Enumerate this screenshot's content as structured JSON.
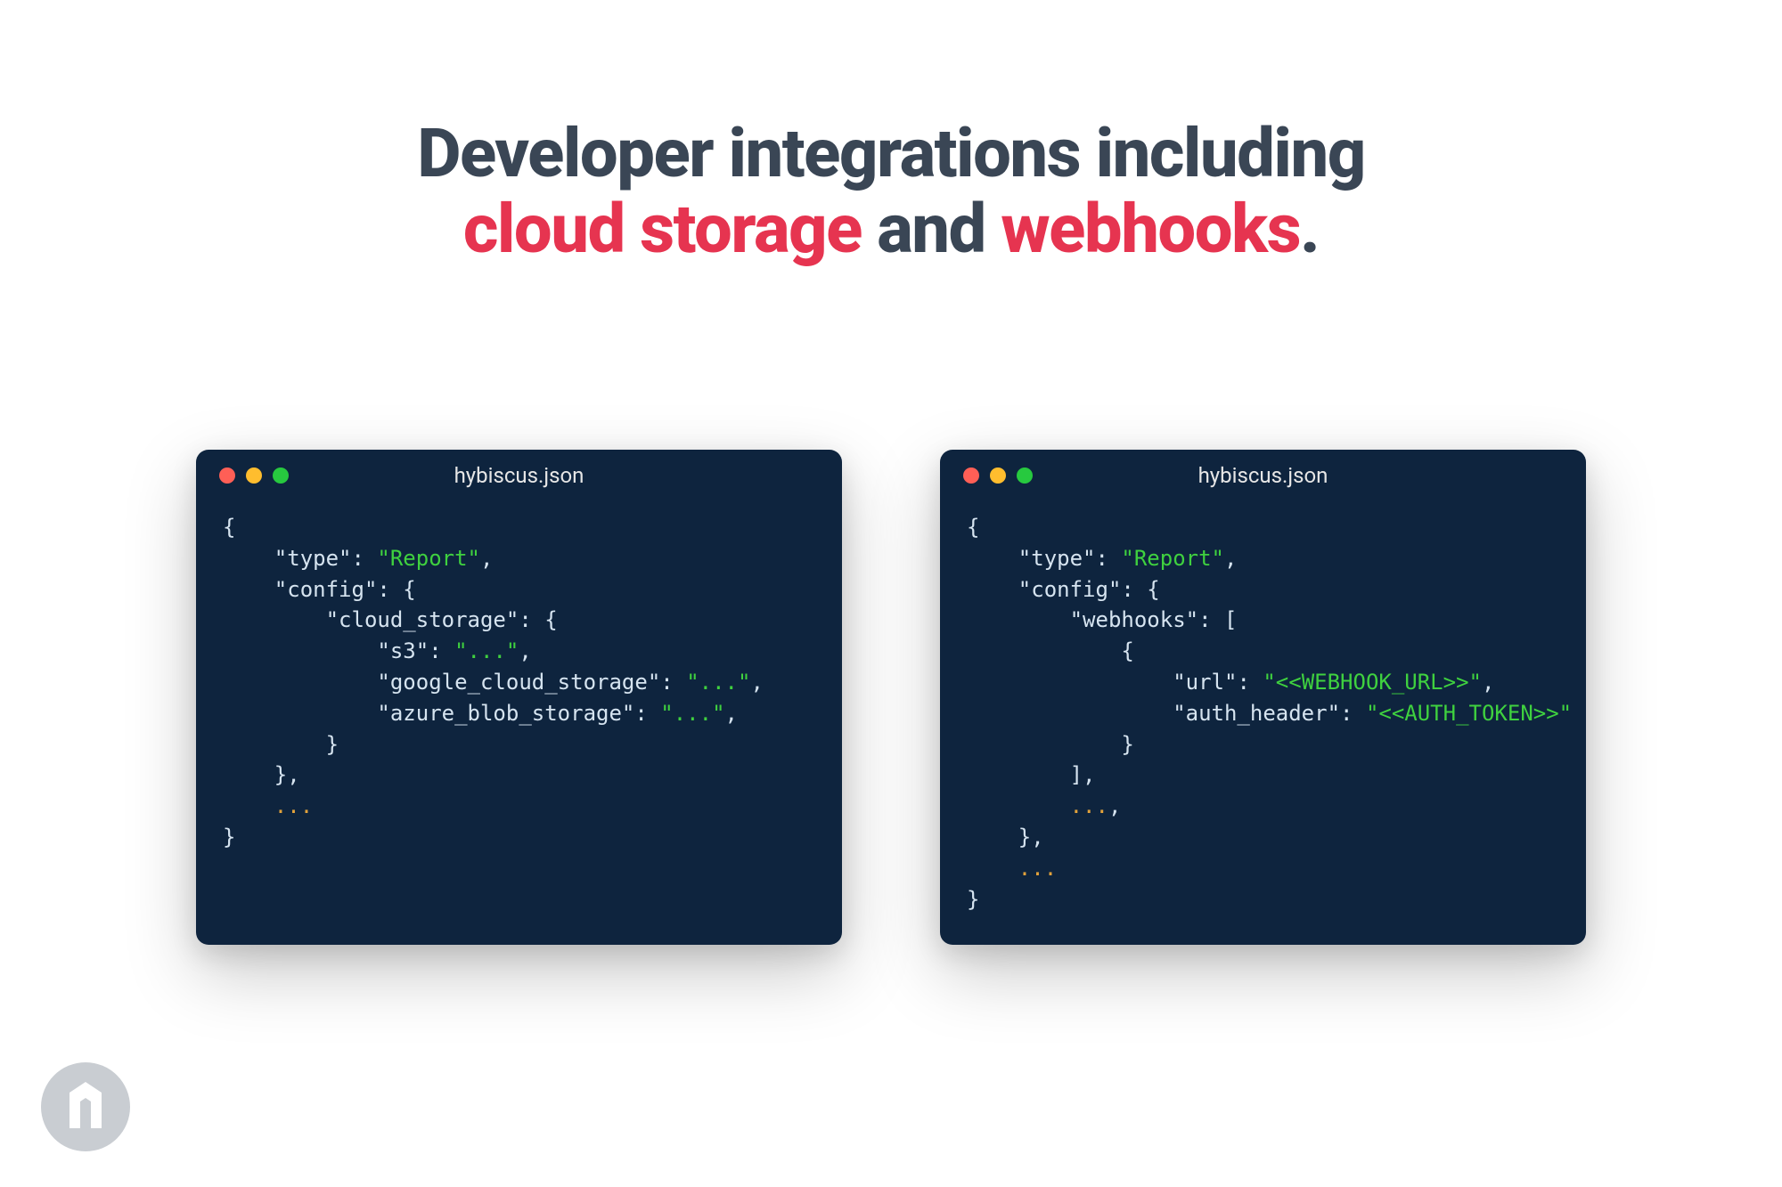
{
  "headline": {
    "prefix": "Developer integrations including",
    "accent1": "cloud storage",
    "mid": " and ",
    "accent2": "webhooks",
    "suffix": "."
  },
  "colors": {
    "text": "#3a4655",
    "accent": "#e63450",
    "card_bg": "#0e243e",
    "code_default": "#d6e4f0",
    "code_string": "#3fd13f",
    "code_ellipsis": "#e2a23b",
    "traffic_red": "#ff5f56",
    "traffic_yellow": "#ffbd2e",
    "traffic_green": "#27c93f",
    "decor_dot": "#f7d1d6",
    "logo": "#c9cdd2"
  },
  "cards": [
    {
      "filename": "hybiscus.json",
      "tokens": [
        [
          {
            "t": "{",
            "c": "punc"
          }
        ],
        [
          {
            "t": "    ",
            "c": "punc"
          },
          {
            "t": "\"type\"",
            "c": "key"
          },
          {
            "t": ": ",
            "c": "punc"
          },
          {
            "t": "\"Report\"",
            "c": "str"
          },
          {
            "t": ",",
            "c": "punc"
          }
        ],
        [
          {
            "t": "    ",
            "c": "punc"
          },
          {
            "t": "\"config\"",
            "c": "key"
          },
          {
            "t": ": {",
            "c": "punc"
          }
        ],
        [
          {
            "t": "        ",
            "c": "punc"
          },
          {
            "t": "\"cloud_storage\"",
            "c": "key"
          },
          {
            "t": ": {",
            "c": "punc"
          }
        ],
        [
          {
            "t": "            ",
            "c": "punc"
          },
          {
            "t": "\"s3\"",
            "c": "key"
          },
          {
            "t": ": ",
            "c": "punc"
          },
          {
            "t": "\"...\"",
            "c": "str"
          },
          {
            "t": ",",
            "c": "punc"
          }
        ],
        [
          {
            "t": "            ",
            "c": "punc"
          },
          {
            "t": "\"google_cloud_storage\"",
            "c": "key"
          },
          {
            "t": ": ",
            "c": "punc"
          },
          {
            "t": "\"...\"",
            "c": "str"
          },
          {
            "t": ",",
            "c": "punc"
          }
        ],
        [
          {
            "t": "            ",
            "c": "punc"
          },
          {
            "t": "\"azure_blob_storage\"",
            "c": "key"
          },
          {
            "t": ": ",
            "c": "punc"
          },
          {
            "t": "\"...\"",
            "c": "str"
          },
          {
            "t": ",",
            "c": "punc"
          }
        ],
        [
          {
            "t": "        }",
            "c": "punc"
          }
        ],
        [
          {
            "t": "    },",
            "c": "punc"
          }
        ],
        [
          {
            "t": "    ",
            "c": "punc"
          },
          {
            "t": "...",
            "c": "ellip"
          }
        ],
        [
          {
            "t": "}",
            "c": "punc"
          }
        ]
      ]
    },
    {
      "filename": "hybiscus.json",
      "tokens": [
        [
          {
            "t": "{",
            "c": "punc"
          }
        ],
        [
          {
            "t": "    ",
            "c": "punc"
          },
          {
            "t": "\"type\"",
            "c": "key"
          },
          {
            "t": ": ",
            "c": "punc"
          },
          {
            "t": "\"Report\"",
            "c": "str"
          },
          {
            "t": ",",
            "c": "punc"
          }
        ],
        [
          {
            "t": "    ",
            "c": "punc"
          },
          {
            "t": "\"config\"",
            "c": "key"
          },
          {
            "t": ": {",
            "c": "punc"
          }
        ],
        [
          {
            "t": "        ",
            "c": "punc"
          },
          {
            "t": "\"webhooks\"",
            "c": "key"
          },
          {
            "t": ": [",
            "c": "punc"
          }
        ],
        [
          {
            "t": "            {",
            "c": "punc"
          }
        ],
        [
          {
            "t": "                ",
            "c": "punc"
          },
          {
            "t": "\"url\"",
            "c": "key"
          },
          {
            "t": ": ",
            "c": "punc"
          },
          {
            "t": "\"<<WEBHOOK_URL>>\"",
            "c": "str"
          },
          {
            "t": ",",
            "c": "punc"
          }
        ],
        [
          {
            "t": "                ",
            "c": "punc"
          },
          {
            "t": "\"auth_header\"",
            "c": "key"
          },
          {
            "t": ": ",
            "c": "punc"
          },
          {
            "t": "\"<<AUTH_TOKEN>>\"",
            "c": "str"
          }
        ],
        [
          {
            "t": "            }",
            "c": "punc"
          }
        ],
        [
          {
            "t": "        ],",
            "c": "punc"
          }
        ],
        [
          {
            "t": "        ",
            "c": "punc"
          },
          {
            "t": "...",
            "c": "ellip"
          },
          {
            "t": ",",
            "c": "punc"
          }
        ],
        [
          {
            "t": "    },",
            "c": "punc"
          }
        ],
        [
          {
            "t": "    ",
            "c": "punc"
          },
          {
            "t": "...",
            "c": "ellip"
          }
        ],
        [
          {
            "t": "}",
            "c": "punc"
          }
        ]
      ]
    }
  ],
  "decor_dot_count": 84
}
